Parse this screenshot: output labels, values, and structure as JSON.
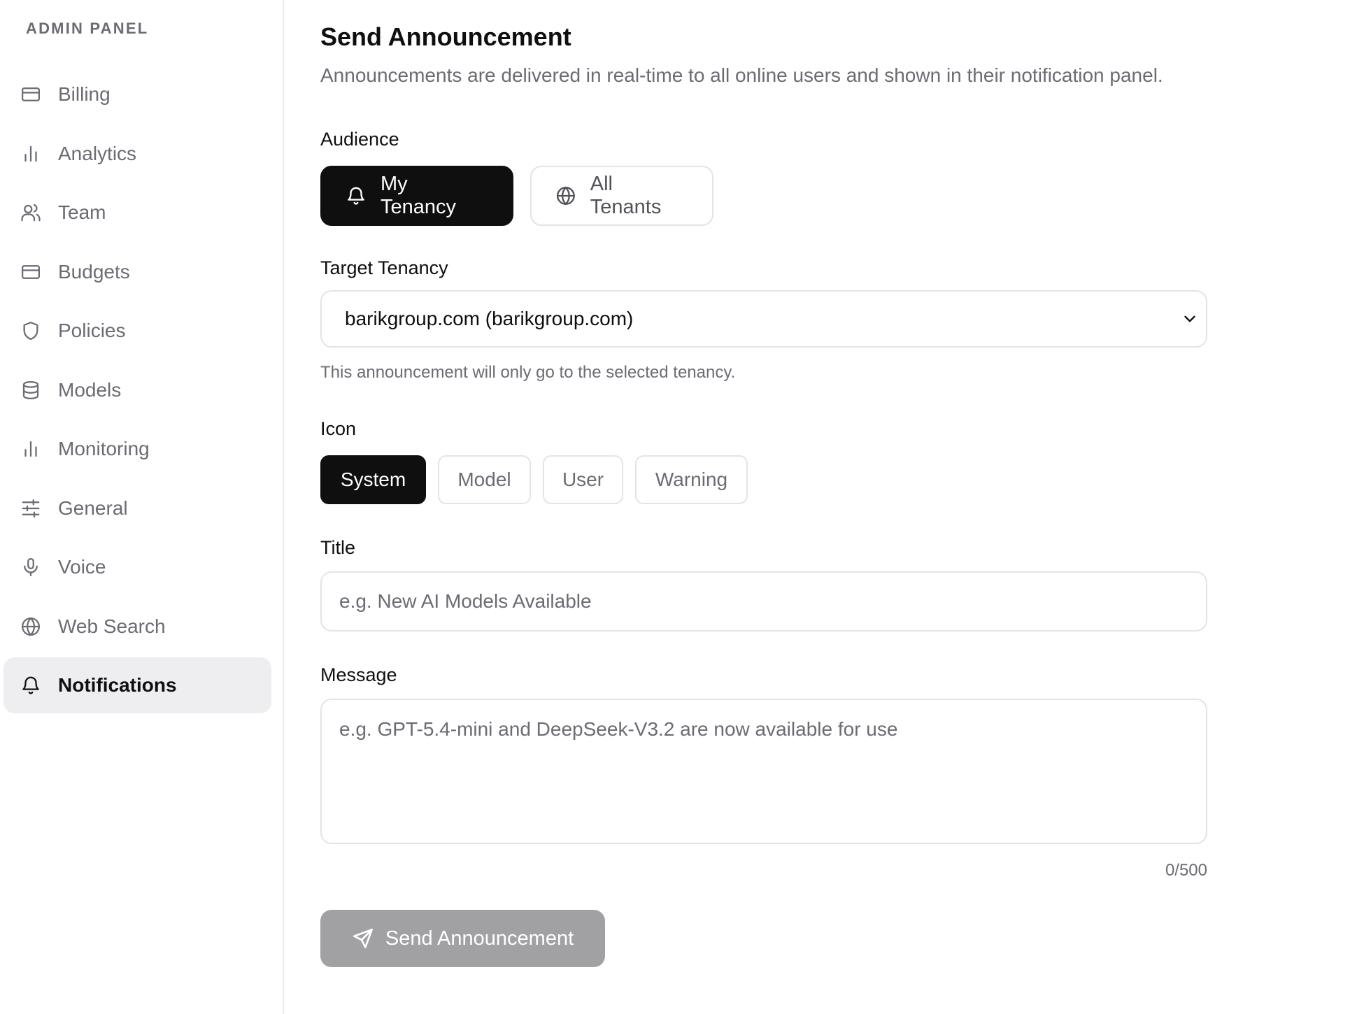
{
  "sidebar": {
    "heading": "ADMIN PANEL",
    "items": [
      {
        "label": "Billing",
        "icon": "credit-card-icon",
        "active": false
      },
      {
        "label": "Analytics",
        "icon": "bar-chart-icon",
        "active": false
      },
      {
        "label": "Team",
        "icon": "users-icon",
        "active": false
      },
      {
        "label": "Budgets",
        "icon": "credit-card-icon",
        "active": false
      },
      {
        "label": "Policies",
        "icon": "shield-icon",
        "active": false
      },
      {
        "label": "Models",
        "icon": "database-icon",
        "active": false
      },
      {
        "label": "Monitoring",
        "icon": "bar-chart-icon",
        "active": false
      },
      {
        "label": "General",
        "icon": "sliders-icon",
        "active": false
      },
      {
        "label": "Voice",
        "icon": "microphone-icon",
        "active": false
      },
      {
        "label": "Web Search",
        "icon": "globe-icon",
        "active": false
      },
      {
        "label": "Notifications",
        "icon": "bell-icon",
        "active": true
      }
    ]
  },
  "main": {
    "title": "Send Announcement",
    "description": "Announcements are delivered in real-time to all online users and shown in their notification panel.",
    "audience": {
      "label": "Audience",
      "options": [
        {
          "label": "My Tenancy",
          "icon": "bell-icon",
          "selected": true
        },
        {
          "label": "All Tenants",
          "icon": "globe-icon",
          "selected": false
        }
      ]
    },
    "target_tenancy": {
      "label": "Target Tenancy",
      "selected_value": "barikgroup.com (barikgroup.com)",
      "helper": "This announcement will only go to the selected tenancy."
    },
    "icon_picker": {
      "label": "Icon",
      "options": [
        {
          "label": "System",
          "selected": true
        },
        {
          "label": "Model",
          "selected": false
        },
        {
          "label": "User",
          "selected": false
        },
        {
          "label": "Warning",
          "selected": false
        }
      ]
    },
    "title_field": {
      "label": "Title",
      "value": "",
      "placeholder": "e.g. New AI Models Available"
    },
    "message_field": {
      "label": "Message",
      "value": "",
      "placeholder": "e.g. GPT-5.4-mini and DeepSeek-V3.2 are now available for use",
      "counter": "0/500"
    },
    "send_button": {
      "label": "Send Announcement",
      "icon": "send-icon",
      "disabled": true
    }
  },
  "colors": {
    "primary": "#0f0f10",
    "muted_text": "#6b6b74",
    "border": "#e4e4e8",
    "active_nav_bg": "#eeeef1",
    "disabled_button": "#a1a1a3"
  }
}
